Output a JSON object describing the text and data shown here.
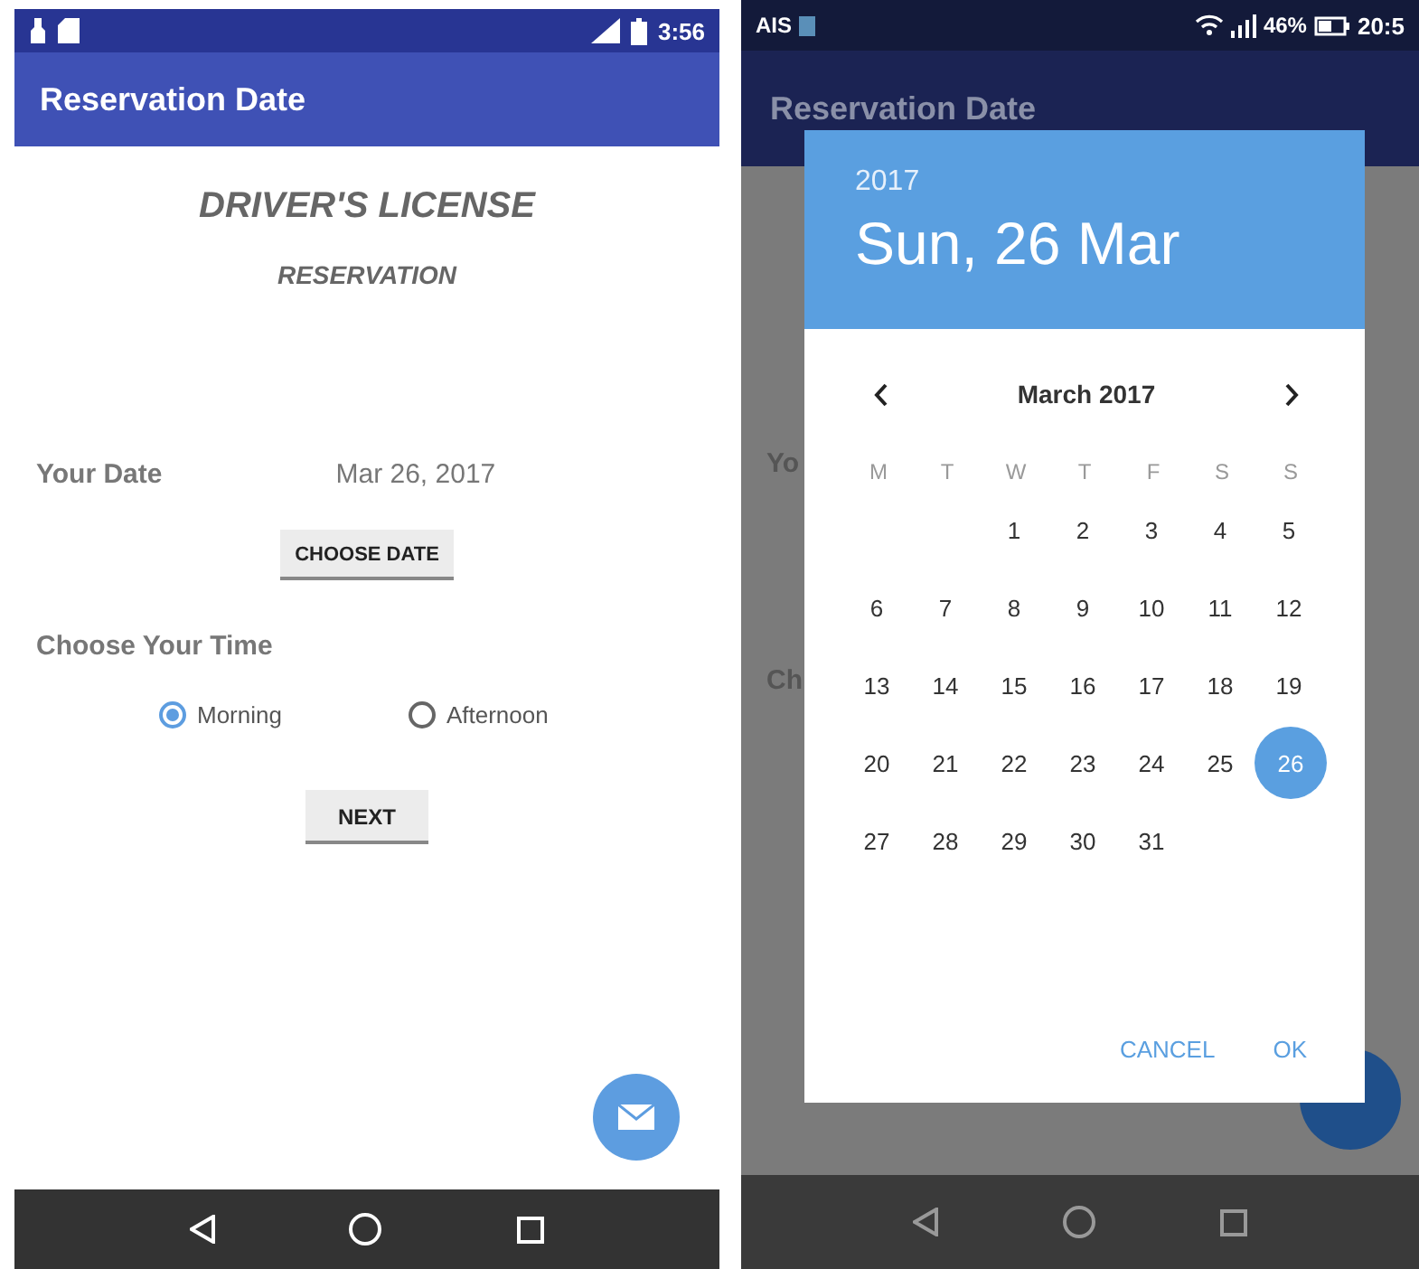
{
  "left_screen": {
    "status_bar": {
      "time": "3:56"
    },
    "app_bar": {
      "title": "Reservation Date"
    },
    "heading": "DRIVER'S LICENSE",
    "subheading": "RESERVATION",
    "date_label": "Your Date",
    "date_value": "Mar 26, 2017",
    "choose_date_button": "CHOOSE DATE",
    "time_label": "Choose Your Time",
    "time_options": [
      {
        "label": "Morning",
        "selected": true
      },
      {
        "label": "Afternoon",
        "selected": false
      }
    ],
    "next_button": "NEXT"
  },
  "right_screen": {
    "status_bar": {
      "carrier": "AIS",
      "battery": "46%",
      "time": "20:5"
    },
    "app_bar": {
      "title": "Reservation Date"
    },
    "background_labels": [
      "Yo",
      "Ch"
    ],
    "dialog": {
      "year": "2017",
      "date": "Sun, 26 Mar",
      "month": "March 2017",
      "weekdays": [
        "M",
        "T",
        "W",
        "T",
        "F",
        "S",
        "S"
      ],
      "weeks": [
        [
          {
            "day": "1",
            "selected": false
          },
          {
            "day": "2",
            "selected": false
          },
          {
            "day": "3",
            "selected": false
          },
          {
            "day": "4",
            "selected": false
          },
          {
            "day": "5",
            "selected": false
          }
        ],
        [
          {
            "day": "6",
            "selected": false
          },
          {
            "day": "7",
            "selected": false
          },
          {
            "day": "8",
            "selected": false
          },
          {
            "day": "9",
            "selected": false
          },
          {
            "day": "10",
            "selected": false
          },
          {
            "day": "11",
            "selected": false
          },
          {
            "day": "12",
            "selected": false
          }
        ],
        [
          {
            "day": "13",
            "selected": false
          },
          {
            "day": "14",
            "selected": false
          },
          {
            "day": "15",
            "selected": false
          },
          {
            "day": "16",
            "selected": false
          },
          {
            "day": "17",
            "selected": false
          },
          {
            "day": "18",
            "selected": false
          },
          {
            "day": "19",
            "selected": false
          }
        ],
        [
          {
            "day": "20",
            "selected": false
          },
          {
            "day": "21",
            "selected": false
          },
          {
            "day": "22",
            "selected": false
          },
          {
            "day": "23",
            "selected": false
          },
          {
            "day": "24",
            "selected": false
          },
          {
            "day": "25",
            "selected": false
          },
          {
            "day": "26",
            "selected": true
          }
        ],
        [
          {
            "day": "27",
            "selected": false
          },
          {
            "day": "28",
            "selected": false
          },
          {
            "day": "29",
            "selected": false
          },
          {
            "day": "30",
            "selected": false
          },
          {
            "day": "31",
            "selected": false
          }
        ]
      ],
      "buttons": [
        "CANCEL",
        "OK"
      ]
    }
  }
}
